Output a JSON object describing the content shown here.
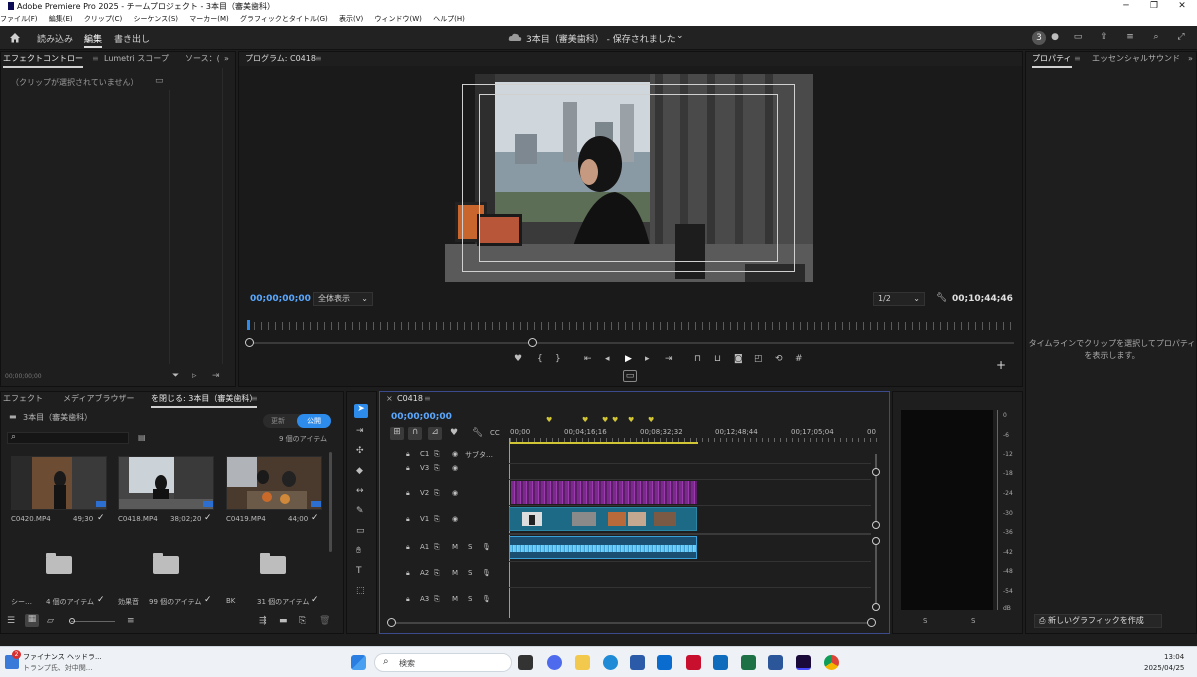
{
  "window": {
    "title": "Adobe Premiere Pro 2025 - チームプロジェクト - 3本目（審美歯科）",
    "minimize": "─",
    "maximize": "❐",
    "close": "✕"
  },
  "menu": [
    "ファイル(F)",
    "編集(E)",
    "クリップ(C)",
    "シーケンス(S)",
    "マーカー(M)",
    "グラフィックとタイトル(G)",
    "表示(V)",
    "ウィンドウ(W)",
    "ヘルプ(H)"
  ],
  "header": {
    "tabs": [
      "読み込み",
      "編集",
      "書き出し"
    ],
    "active_tab": "編集",
    "project_status": "3本目（審美歯科） - 保存されました",
    "badge": "3"
  },
  "effect_controls": {
    "tabs": [
      "エフェクトコントロー",
      "Lumetri スコープ",
      "ソース：("
    ],
    "no_clip": "（クリップが選択されていません）",
    "timecode": "00;00;00;00"
  },
  "program": {
    "title": "プログラム: C0418",
    "timecode": "00;00;00;00",
    "zoom": "全体表示",
    "resolution": "1/2",
    "duration": "00;10;44;46"
  },
  "properties": {
    "tabs": [
      "プロパティ",
      "エッセンシャルサウンド"
    ],
    "message": "タイムラインでクリップを選択してプロパティを表示します。",
    "new_graphic": "新しいグラフィックを作成"
  },
  "project": {
    "tabs": [
      "エフェクト",
      "メディアブラウザー",
      "を閉じる: 3本目（審美歯科）"
    ],
    "name": "3本目（審美歯科）",
    "toggle_update": "更新",
    "toggle_public": "公開",
    "item_count": "9 個のアイテム",
    "clips": [
      {
        "name": "C0420.MP4",
        "duration": "49;30"
      },
      {
        "name": "C0418.MP4",
        "duration": "38;02;20"
      },
      {
        "name": "C0419.MP4",
        "duration": "44;00"
      }
    ],
    "bins": [
      {
        "name": "シー…",
        "count": "4 個のアイテム"
      },
      {
        "name": "効果音",
        "count": "99 個のアイテム"
      },
      {
        "name": "BK",
        "count": "31 個のアイテム"
      }
    ]
  },
  "timeline": {
    "tab": "C0418",
    "timecode": "00;00;00;00",
    "ruler": [
      "00;00",
      "00;04;16;16",
      "00;08;32;32",
      "00;12;48;44",
      "00;17;05;04",
      "00"
    ],
    "tracks_video": [
      {
        "name": "C1",
        "label": "サブタ…"
      },
      {
        "name": "V3",
        "label": ""
      },
      {
        "name": "V2",
        "label": ""
      },
      {
        "name": "V1",
        "label": ""
      }
    ],
    "tracks_audio": [
      {
        "name": "A1",
        "m": "M",
        "s": "S"
      },
      {
        "name": "A2",
        "m": "M",
        "s": "S"
      },
      {
        "name": "A3",
        "m": "M",
        "s": "S"
      }
    ]
  },
  "meter": {
    "scale": [
      "0",
      "-6",
      "-12",
      "-18",
      "-24",
      "-30",
      "-36",
      "-42",
      "-48",
      "-54",
      "dB"
    ],
    "channels": [
      "S",
      "S"
    ]
  },
  "taskbar": {
    "news_title": "ファイナンス ヘッドラ...",
    "news_sub": "トランプ氏、対中関...",
    "news_badge": "2",
    "search": "検索",
    "time": "13:04",
    "date": "2025/04/25"
  },
  "colors": {
    "accent": "#2d8ceb",
    "video_clip": "#1c6a86",
    "v2_clip": "#7a2a8a",
    "audio_clip": "#3aa0d8",
    "timecode_blue": "#5aa8ff"
  }
}
